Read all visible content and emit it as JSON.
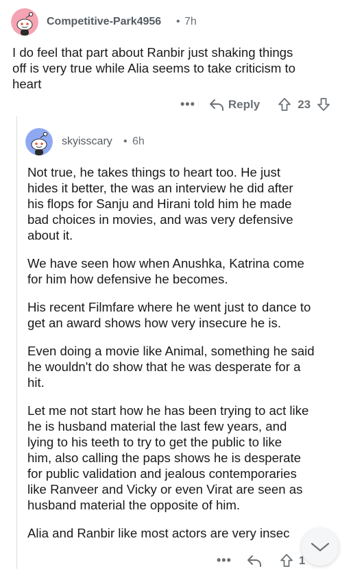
{
  "comment": {
    "username": "Competitive-Park4956",
    "separator": "•",
    "time": "7h",
    "lines": [
      "I do feel that part about Ranbir just shaking things",
      "off is very true while Alia seems to take criticism to",
      "heart"
    ],
    "actions": {
      "more": "•••",
      "reply_label": "Reply",
      "votes": "23"
    }
  },
  "reply": {
    "username": "skyisscary",
    "separator": "•",
    "time": "6h",
    "paragraphs": [
      [
        "Not true, he takes things to heart too. He just",
        "hides it better, the was an interview he did after",
        "his flops for Sanju and Hirani told him he made",
        "bad choices in movies, and was very defensive",
        "about it."
      ],
      [
        "We have seen how when Anushka, Katrina come",
        "for him how defensive he becomes."
      ],
      [
        "His recent Filmfare where he went just to dance to",
        "get an award shows how very insecure he is."
      ],
      [
        "Even doing a movie like Animal, something he said",
        "he wouldn't do show that he was desperate for a",
        "hit."
      ],
      [
        "Let me not start how he has been trying to act like",
        "he is husband material the last few years, and",
        "lying to his teeth to try to get the public to like",
        "him, also calling the paps shows he is desperate",
        "for public validation and jealous contemporaries",
        "like Ranveer and Vicky or even Virat are seen as",
        "husband material the opposite of him."
      ],
      [
        "Alia and Ranbir like most actors are very insec"
      ]
    ],
    "actions": {
      "more": "•••",
      "votes": "1"
    }
  },
  "icons": {
    "avatar1": "snoo-avatar-icon",
    "avatar2": "snoo-avatar-icon",
    "reply": "reply-arrow-icon",
    "upvote": "upvote-arrow-icon",
    "downvote": "downvote-arrow-icon",
    "collapse": "chevron-down-icon"
  },
  "colors": {
    "avatar1_bg": "#f5a3b2",
    "avatar2_bg": "#8ea9f2",
    "meta_gray": "#6b7075",
    "thread_line": "#dadcde"
  }
}
